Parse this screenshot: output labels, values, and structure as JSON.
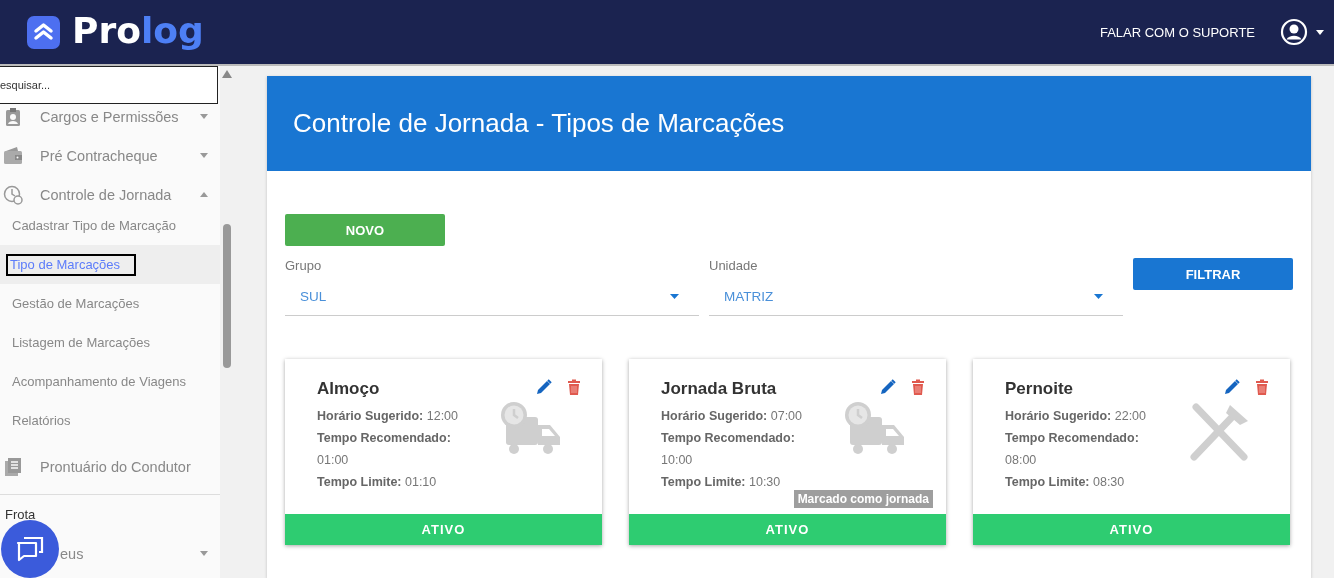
{
  "header": {
    "logo": [
      "Pro",
      "log"
    ],
    "support_link": "FALAR COM O SUPORTE"
  },
  "sidebar": {
    "search": {
      "placeholder": "esquisar..."
    },
    "items": [
      {
        "kind": "group",
        "label": "Cargos e Permissões",
        "expanded": false
      },
      {
        "kind": "group",
        "label": "Pré Contracheque",
        "expanded": false
      },
      {
        "kind": "group",
        "label": "Controle de Jornada",
        "expanded": true
      },
      {
        "kind": "sub",
        "label": "Cadastrar Tipo de Marcação",
        "selected": false
      },
      {
        "kind": "sub",
        "label": "Tipo de Marcações",
        "selected": true
      },
      {
        "kind": "sub",
        "label": "Gestão de Marcações",
        "selected": false
      },
      {
        "kind": "sub",
        "label": "Listagem de Marcações",
        "selected": false
      },
      {
        "kind": "sub",
        "label": "Acompanhamento de Viagens",
        "selected": false
      },
      {
        "kind": "sub",
        "label": "Relatórios",
        "selected": false
      },
      {
        "kind": "group",
        "label": "Prontuário do Condutor"
      },
      {
        "kind": "section",
        "label": "Frota"
      },
      {
        "kind": "group",
        "label": "eus",
        "expanded": false
      }
    ]
  },
  "page": {
    "title": "Controle de Jornada - Tipos de Marcações",
    "new_button": "NOVO",
    "filters": [
      {
        "label": "Grupo",
        "value": "SUL"
      },
      {
        "label": "Unidade",
        "value": "MATRIZ"
      }
    ],
    "filter_button": "FILTRAR",
    "cards": [
      {
        "title": "Almoço",
        "fields": [
          {
            "label": "Horário Sugerido:",
            "value": "12:00"
          },
          {
            "label": "Tempo Recomendado:",
            "value": "01:00"
          },
          {
            "label": "Tempo Limite:",
            "value": "01:10"
          }
        ],
        "status": {
          "label": "ATIVO",
          "active": true
        }
      },
      {
        "title": "Jornada Bruta",
        "badge": "Marcado como jornada",
        "fields": [
          {
            "label": "Horário Sugerido:",
            "value": "07:00"
          },
          {
            "label": "Tempo Recomendado:",
            "value": "10:00"
          },
          {
            "label": "Tempo Limite:",
            "value": "10:30"
          }
        ],
        "status": {
          "label": "ATIVO",
          "active": true
        }
      },
      {
        "title": "Pernoite",
        "fields": [
          {
            "label": "Horário Sugerido:",
            "value": "22:00"
          },
          {
            "label": "Tempo Recomendado:",
            "value": "08:00"
          },
          {
            "label": "Tempo Limite:",
            "value": "08:30"
          }
        ],
        "status": {
          "label": "ATIVO",
          "active": true
        }
      }
    ]
  }
}
